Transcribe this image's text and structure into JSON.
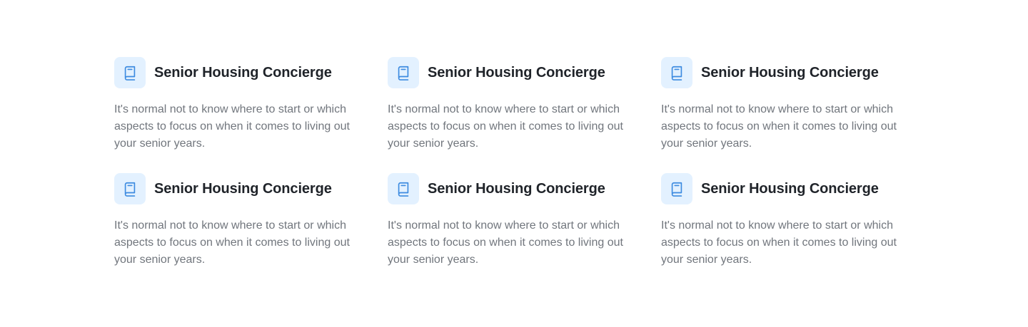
{
  "colors": {
    "accent": "#3d8be0",
    "icon_background": "#e3f1ff",
    "title": "#1f2329",
    "body_text": "#71767d"
  },
  "features": [
    {
      "icon": "book-icon",
      "title": "Senior Housing Concierge",
      "description": "It's normal not to know where to start or which aspects to focus on when it comes to living out your senior years."
    },
    {
      "icon": "book-icon",
      "title": "Senior Housing Concierge",
      "description": "It's normal not to know where to start or which aspects to focus on when it comes to living out your senior years."
    },
    {
      "icon": "book-icon",
      "title": "Senior Housing Concierge",
      "description": "It's normal not to know where to start or which aspects to focus on when it comes to living out your senior years."
    },
    {
      "icon": "book-icon",
      "title": "Senior Housing Concierge",
      "description": "It's normal not to know where to start or which aspects to focus on when it comes to living out your senior years."
    },
    {
      "icon": "book-icon",
      "title": "Senior Housing Concierge",
      "description": "It's normal not to know where to start or which aspects to focus on when it comes to living out your senior years."
    },
    {
      "icon": "book-icon",
      "title": "Senior Housing Concierge",
      "description": "It's normal not to know where to start or which aspects to focus on when it comes to living out your senior years."
    }
  ]
}
